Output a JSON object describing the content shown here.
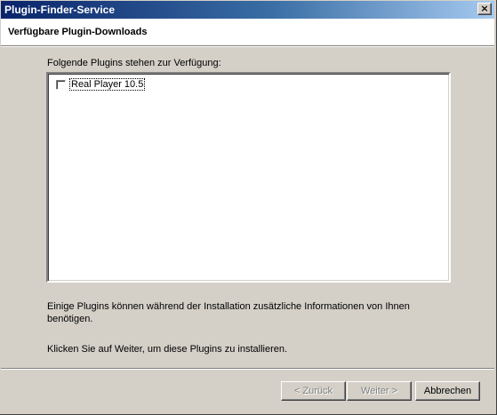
{
  "window": {
    "title": "Plugin-Finder-Service",
    "close_glyph": "×"
  },
  "header": {
    "title": "Verfügbare Plugin-Downloads"
  },
  "main": {
    "intro": "Folgende Plugins stehen zur Verfügung:",
    "plugins": [
      {
        "label": "Real Player 10.5",
        "checked": false
      }
    ],
    "info_text": "Einige Plugins können während der Installation zusätzliche Informationen von Ihnen benötigen.",
    "instruction": "Klicken Sie auf Weiter, um diese Plugins zu installieren."
  },
  "buttons": {
    "back": "< Zurück",
    "next": "Weiter >",
    "cancel": "Abbrechen"
  }
}
